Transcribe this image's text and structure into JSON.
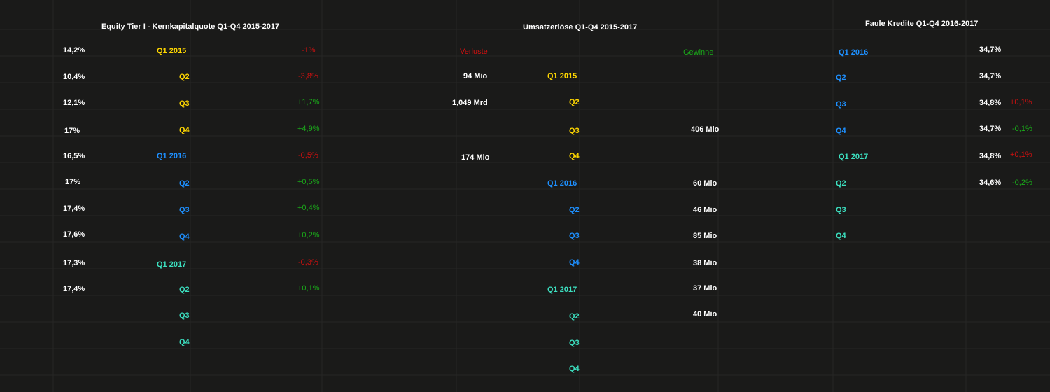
{
  "colors": {
    "background": "#1a1a19",
    "grid": "#2a2a29",
    "white": "#ffffff",
    "y2015": "#ffd700",
    "y2016": "#1e90ff",
    "y2017": "#3ce0c0",
    "negative": "#d01010",
    "positive": "#1aa81a"
  },
  "equity": {
    "title": "Equity Tier I - Kernkapitalquote Q1-Q4 2015-2017",
    "values": [
      "14,2%",
      "10,4%",
      "12,1%",
      "17%",
      "16,5%",
      "17%",
      "17,4%",
      "17,6%",
      "17,3%",
      "17,4%"
    ],
    "quarters": [
      "Q1 2015",
      "Q2",
      "Q3",
      "Q4",
      "Q1 2016",
      "Q2",
      "Q3",
      "Q4",
      "Q1 2017",
      "Q2",
      "Q3",
      "Q4"
    ],
    "changes": [
      "-1%",
      "-3,8%",
      "+1,7%",
      "+4,9%",
      "-0,5%",
      "+0,5%",
      "+0,4%",
      "+0,2%",
      "-0,3%",
      "+0,1%"
    ]
  },
  "umsatz": {
    "title": "Umsatzerlöse Q1-Q4 2015-2017",
    "loss_label": "Verluste",
    "gain_label": "Gewinne",
    "losses": [
      "94 Mio",
      "1,049 Mrd",
      "174 Mio"
    ],
    "quarters": [
      "Q1 2015",
      "Q2",
      "Q3",
      "Q4",
      "Q1 2016",
      "Q2",
      "Q3",
      "Q4",
      "Q1 2017",
      "Q2",
      "Q3",
      "Q4"
    ],
    "gains": [
      "406 Mio",
      "60 Mio",
      "46 Mio",
      "85 Mio",
      "38 Mio",
      "37 Mio",
      "40 Mio"
    ]
  },
  "faule": {
    "title": "Faule Kredite Q1-Q4 2016-2017",
    "quarters": [
      "Q1 2016",
      "Q2",
      "Q3",
      "Q4",
      "Q1 2017",
      "Q2",
      "Q3",
      "Q4"
    ],
    "values": [
      "34,7%",
      "34,7%",
      "34,8%",
      "34,7%",
      "34,8%",
      "34,6%"
    ],
    "changes": [
      "+0,1%",
      "-0,1%",
      "+0,1%",
      "-0,2%"
    ]
  }
}
